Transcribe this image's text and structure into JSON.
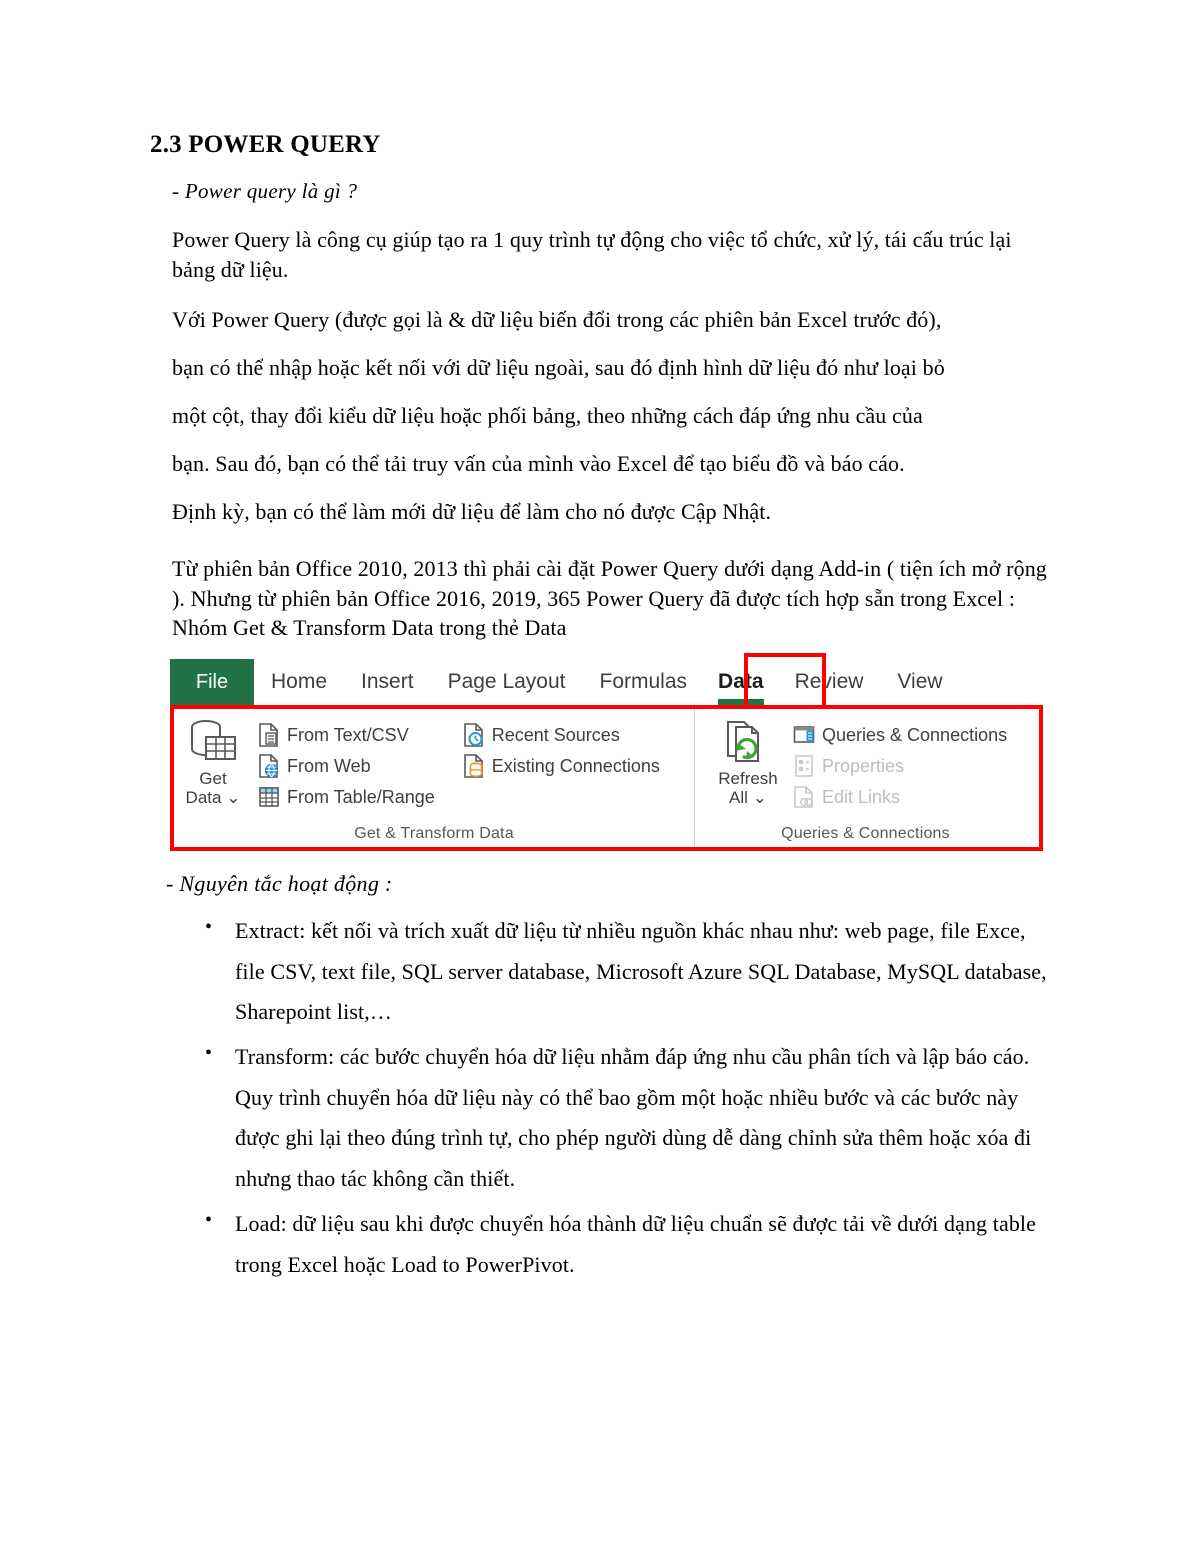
{
  "document": {
    "title": "2.3 POWER QUERY",
    "subhead_1": "- Power query là gì ?",
    "paragraphs": {
      "p1": "Power Query là công cụ giúp tạo ra 1 quy trình tự động cho việc tổ chức, xử lý, tái cấu trúc lại bảng dữ liệu.",
      "p2_line1": "Với Power Query (được gọi là & dữ liệu biến đổi trong các phiên bản Excel trước đó),",
      "p2_line2": "bạn có thể nhập hoặc kết nối với dữ liệu ngoài, sau đó định hình dữ liệu đó như loại bỏ",
      "p2_line3": "một cột, thay đổi kiểu dữ liệu hoặc phối bảng, theo những cách đáp ứng nhu cầu của",
      "p2_line4": "bạn. Sau đó, bạn có thể tải truy vấn của mình vào Excel để tạo biểu đồ và báo cáo.",
      "p2_line5": "Định kỳ, bạn có thể làm mới dữ liệu để làm cho nó được Cập Nhật.",
      "p3": "Từ phiên bản Office 2010, 2013 thì phải cài đặt Power Query dưới dạng Add-in ( tiện ích mở rộng ). Nhưng từ phiên bản Office 2016, 2019, 365 Power Query đã được tích hợp sẵn trong Excel : Nhóm Get & Transform Data trong thẻ Data"
    },
    "subhead_2": "- Nguyên tắc hoạt động :",
    "bullets": [
      "Extract: kết nối và trích xuất dữ liệu từ nhiều nguồn khác nhau như: web page, file Exce, file CSV, text file, SQL server database, Microsoft Azure SQL Database, MySQL database, Sharepoint list,…",
      "Transform: các bước chuyển hóa dữ liệu nhằm đáp ứng nhu cầu phân tích và lập báo cáo. Quy trình chuyển hóa dữ liệu này có thể bao gồm một hoặc nhiều bước và các bước này được ghi lại theo đúng trình tự, cho phép người dùng dễ dàng chỉnh sửa thêm hoặc xóa đi nhưng thao tác không cần thiết.",
      "Load: dữ liệu sau khi được chuyển hóa thành dữ liệu chuẩn sẽ được tải về dưới dạng table trong Excel hoặc Load to PowerPivot."
    ]
  },
  "ribbon": {
    "tabs": [
      {
        "label": "File",
        "active": false
      },
      {
        "label": "Home",
        "active": false
      },
      {
        "label": "Insert",
        "active": false
      },
      {
        "label": "Page Layout",
        "active": false
      },
      {
        "label": "Formulas",
        "active": false
      },
      {
        "label": "Data",
        "active": true
      },
      {
        "label": "Review",
        "active": false
      },
      {
        "label": "View",
        "active": false
      }
    ],
    "groups": {
      "get_transform": {
        "label": "Get & Transform Data",
        "big_button": {
          "line1": "Get",
          "line2": "Data"
        },
        "column_1": [
          {
            "label": "From Text/CSV",
            "icon": "file-text-icon",
            "disabled": false
          },
          {
            "label": "From Web",
            "icon": "file-globe-icon",
            "disabled": false
          },
          {
            "label": "From Table/Range",
            "icon": "table-grid-icon",
            "disabled": false
          }
        ],
        "column_2": [
          {
            "label": "Recent Sources",
            "icon": "file-clock-icon",
            "disabled": false
          },
          {
            "label": "Existing Connections",
            "icon": "file-database-icon",
            "disabled": false
          }
        ]
      },
      "queries_connections": {
        "label": "Queries & Connections",
        "big_button": {
          "line1": "Refresh",
          "line2": "All"
        },
        "column_1": [
          {
            "label": "Queries & Connections",
            "icon": "queries-pane-icon",
            "disabled": false
          },
          {
            "label": "Properties",
            "icon": "properties-icon",
            "disabled": true
          },
          {
            "label": "Edit Links",
            "icon": "edit-links-icon",
            "disabled": true
          }
        ]
      }
    },
    "colors": {
      "file_tab_green": "#217346",
      "highlight_red": "#ff0000",
      "disabled_grey": "#bdbdbd",
      "accent_blue": "#2a97d8",
      "accent_orange": "#e8962c",
      "refresh_green": "#3fa535"
    }
  }
}
